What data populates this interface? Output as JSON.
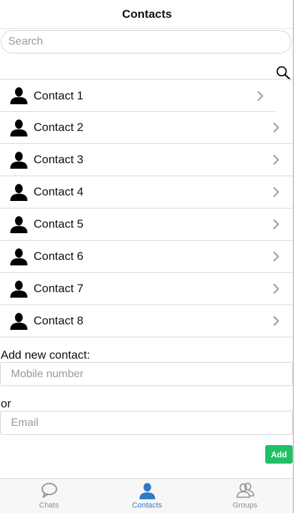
{
  "header": {
    "title": "Contacts"
  },
  "search": {
    "placeholder": "Search"
  },
  "contacts": [
    {
      "name": "Contact 1"
    },
    {
      "name": "Contact 2"
    },
    {
      "name": "Contact 3"
    },
    {
      "name": "Contact 4"
    },
    {
      "name": "Contact 5"
    },
    {
      "name": "Contact 6"
    },
    {
      "name": "Contact 7"
    },
    {
      "name": "Contact 8"
    }
  ],
  "add_contact": {
    "label": "Add new contact:",
    "mobile_placeholder": "Mobile number",
    "or_label": "or",
    "email_placeholder": "Email",
    "add_button": "Add"
  },
  "tabs": [
    {
      "label": "Chats",
      "icon": "chat-bubble-icon",
      "active": false
    },
    {
      "label": "Contacts",
      "icon": "person-icon",
      "active": true
    },
    {
      "label": "Groups",
      "icon": "group-icon",
      "active": false
    }
  ],
  "colors": {
    "accent": "#2f7bc4",
    "add_button": "#22c064",
    "inactive_tab": "#8e8e8e"
  }
}
